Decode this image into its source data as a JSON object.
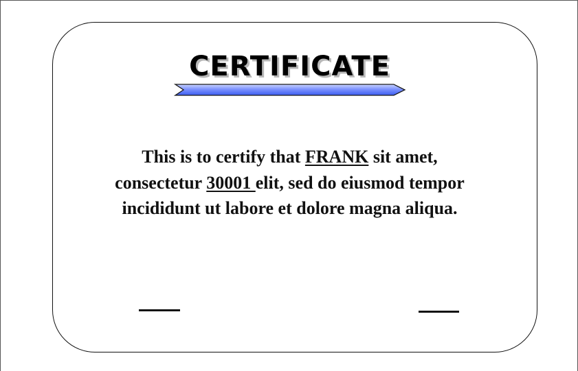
{
  "certificate": {
    "title": "CERTIFICATE",
    "colors": {
      "ribbon_fill_light": "#a9b9ff",
      "ribbon_fill_dark": "#3a5cf0",
      "ribbon_outline": "#1a1a1a",
      "frame_border": "#111111",
      "text": "#111111"
    },
    "body": {
      "line1_prefix": "This is to certify that ",
      "name": "FRANK",
      "line1_suffix": " sit amet,",
      "line2_prefix": "consectetur ",
      "number": "30001 ",
      "line2_suffix": "elit, sed do eiusmod tempor",
      "line3": "incididunt ut labore et dolore magna aliqua."
    }
  }
}
